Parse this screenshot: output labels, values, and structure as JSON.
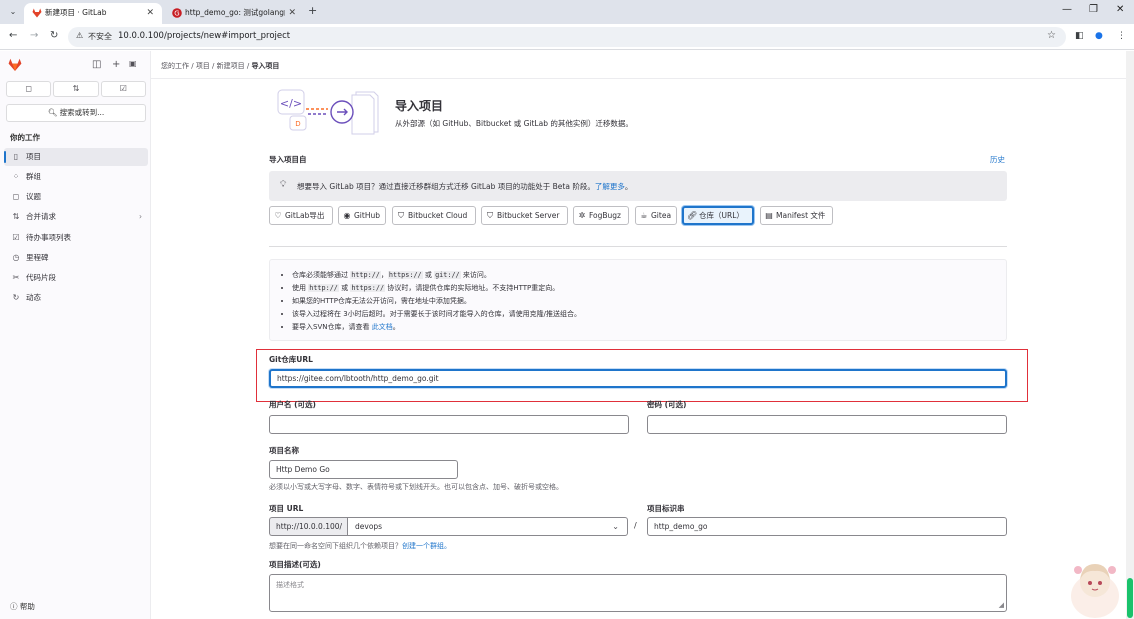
{
  "browser": {
    "tabs": [
      {
        "title": "新建项目 · GitLab",
        "active": true
      },
      {
        "title": "http_demo_go: 测试golang的",
        "active": false
      }
    ],
    "not_secure": "不安全",
    "url": "10.0.0.100/projects/new#import_project"
  },
  "sidebar": {
    "search": "搜索或转到...",
    "section": "你的工作",
    "items": [
      {
        "label": "项目",
        "icon": "project-icon"
      },
      {
        "label": "群组",
        "icon": "group-icon"
      },
      {
        "label": "议题",
        "icon": "issues-icon"
      },
      {
        "label": "合并请求",
        "icon": "merge-request-icon"
      },
      {
        "label": "待办事项列表",
        "icon": "todo-icon"
      },
      {
        "label": "里程碑",
        "icon": "milestone-icon"
      },
      {
        "label": "代码片段",
        "icon": "snippet-icon"
      },
      {
        "label": "动态",
        "icon": "activity-icon"
      }
    ],
    "help": "帮助"
  },
  "breadcrumb": [
    "您的工作",
    "项目",
    "新建项目",
    "导入项目"
  ],
  "header": {
    "title": "导入项目",
    "subtitle": "从外部源（如 GitHub、Bitbucket 或 GitLab 的其他实例）迁移数据。"
  },
  "import_from": {
    "label": "导入项目自",
    "history": "历史"
  },
  "alert": {
    "text": "想要导入 GitLab 项目？通过直接迁移群组方式迁移 GitLab 项目的功能处于 Beta 阶段。",
    "link": "了解更多"
  },
  "sources": [
    {
      "label": "GitLab导出",
      "icon": "gitlab-export-icon",
      "selected": false
    },
    {
      "label": "GitHub",
      "icon": "github-icon",
      "selected": false
    },
    {
      "label": "Bitbucket Cloud",
      "icon": "bitbucket-icon",
      "selected": false
    },
    {
      "label": "Bitbucket Server",
      "icon": "bitbucket-server-icon",
      "selected": false
    },
    {
      "label": "FogBugz",
      "icon": "bug-icon",
      "selected": false
    },
    {
      "label": "Gitea",
      "icon": "gitea-icon",
      "selected": false
    },
    {
      "label": "仓库（URL）",
      "icon": "link-icon",
      "selected": true
    },
    {
      "label": "Manifest 文件",
      "icon": "document-icon",
      "selected": false
    }
  ],
  "info": {
    "line1_a": "仓库必须能够通过 ",
    "line1_c1": "http://",
    "line1_b": "，",
    "line1_c2": "https://",
    "line1_c": " 或 ",
    "line1_c3": "git://",
    "line1_d": " 来访问。",
    "line2_a": "使用 ",
    "line2_c1": "http://",
    "line2_b": " 或 ",
    "line2_c2": "https://",
    "line2_c": " 协议时，请提供仓库的实际地址。不支持HTTP重定向。",
    "line3": "如果您的HTTP仓库无法公开访问，需在地址中添加凭据。",
    "line4": "该导入过程将在 3小时后超时。对于需要长于该时间才能导入的仓库，请使用克隆/推送组合。",
    "line5_a": "要导入SVN仓库，请查看 ",
    "line5_link": "此文档",
    "line5_b": "。"
  },
  "form": {
    "git_url_label": "Git仓库URL",
    "git_url_value": "https://gitee.com/lbtooth/http_demo_go.git",
    "username_label": "用户名 (可选)",
    "password_label": "密码 (可选)",
    "project_name_label": "项目名称",
    "project_name_value": "Http Demo Go",
    "project_name_help": "必须以小写或大写字母、数字、表情符号或下划线开头。也可以包含点、加号、破折号或空格。",
    "project_url_label": "项目 URL",
    "project_url_prefix": "http://10.0.0.100/",
    "namespace": "devops",
    "slash": "/",
    "slug_label": "项目标识串",
    "slug_value": "http_demo_go",
    "namespace_help": "想要在同一命名空间下组织几个依赖项目？",
    "namespace_link": "创建一个群组。",
    "description_label": "项目描述(可选)",
    "description_placeholder": "描述格式"
  }
}
